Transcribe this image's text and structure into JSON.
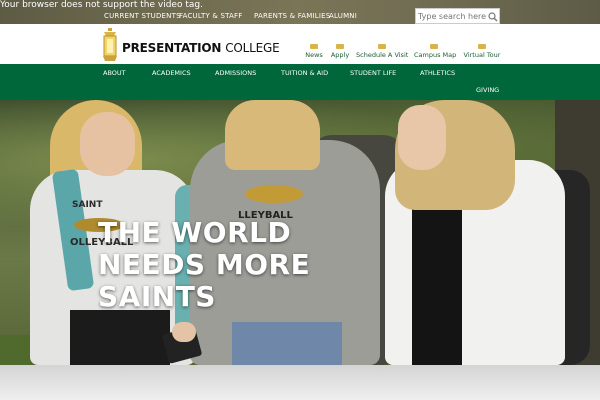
{
  "notice": "Your browser does not support the video tag.",
  "utility_nav": {
    "links": [
      "CURRENT STUDENTS",
      "FACULTY & STAFF",
      "PARENTS & FAMILIES",
      "ALUMNI"
    ],
    "search_placeholder": "Type search here..."
  },
  "brand": {
    "name_bold": "PRESENTATION",
    "name_light": "COLLEGE"
  },
  "quick_links": [
    "News",
    "Apply",
    "Schedule A Visit",
    "Campus Map",
    "Virtual Tour"
  ],
  "main_nav": [
    "ABOUT",
    "ACADEMICS",
    "ADMISSIONS",
    "TUITION & AID",
    "STUDENT LIFE",
    "ATHLETICS",
    "GIVING"
  ],
  "hero": {
    "title_lines": [
      "THE WORLD",
      "NEEDS MORE",
      "SAINTS"
    ],
    "shirt_text_1": "SAINT",
    "shirt_text_2": "OLLEYBALL",
    "shirt_text_3": "LLEYBALL"
  },
  "colors": {
    "green": "#00673a",
    "gold": "#d9b44a"
  },
  "icons": {
    "search": "magnifier-icon",
    "logo": "lantern-icon"
  }
}
